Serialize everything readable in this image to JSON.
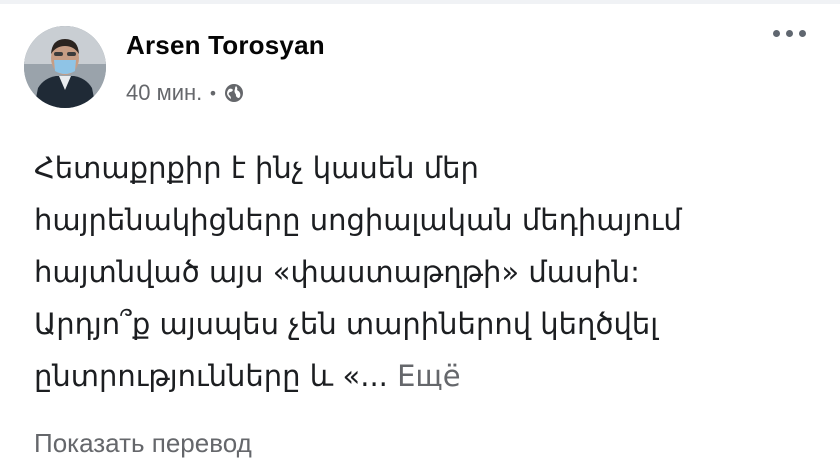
{
  "post": {
    "author": "Arsen Torosyan",
    "time": "40 мин.",
    "separator": "•",
    "privacy_icon": "globe-icon",
    "more_icon": "more-options-icon",
    "text_lines": [
      "Հետաքրքիր է ինչ կասեն մեր",
      "հայրենակիցները սոցիալական մեդիայում",
      "հայտնված այս «փաստաթղթի» մասին:",
      "Արդյո՞ք այսպես չեն տարիներով կեղծվել",
      "ընտրությունները և «..."
    ],
    "see_more": "Ещё",
    "translate": "Показать перевод"
  }
}
